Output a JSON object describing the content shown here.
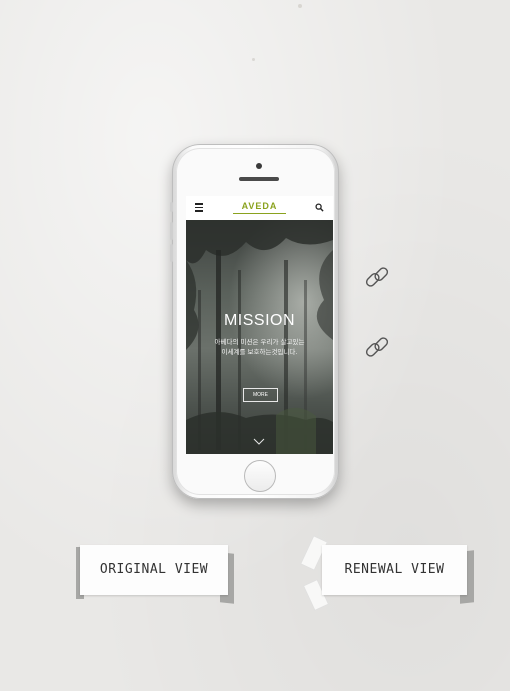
{
  "site": {
    "logo": "AVEDA"
  },
  "hero": {
    "title": "MISSION",
    "subtitle_line1": "아베다의 미션은 우리가 살고있는",
    "subtitle_line2": "이세계를 보호하는것입니다.",
    "more_label": "MORE"
  },
  "labels": {
    "original": "ORIGINAL VIEW",
    "renewal": "RENEWAL VIEW"
  },
  "colors": {
    "background": "#e9e8e6",
    "brand": "#8aa21e",
    "tag_shadow": "#a7a7a5"
  },
  "icons": [
    "menu-icon",
    "search-icon",
    "chevron-down-icon",
    "link-icon"
  ]
}
